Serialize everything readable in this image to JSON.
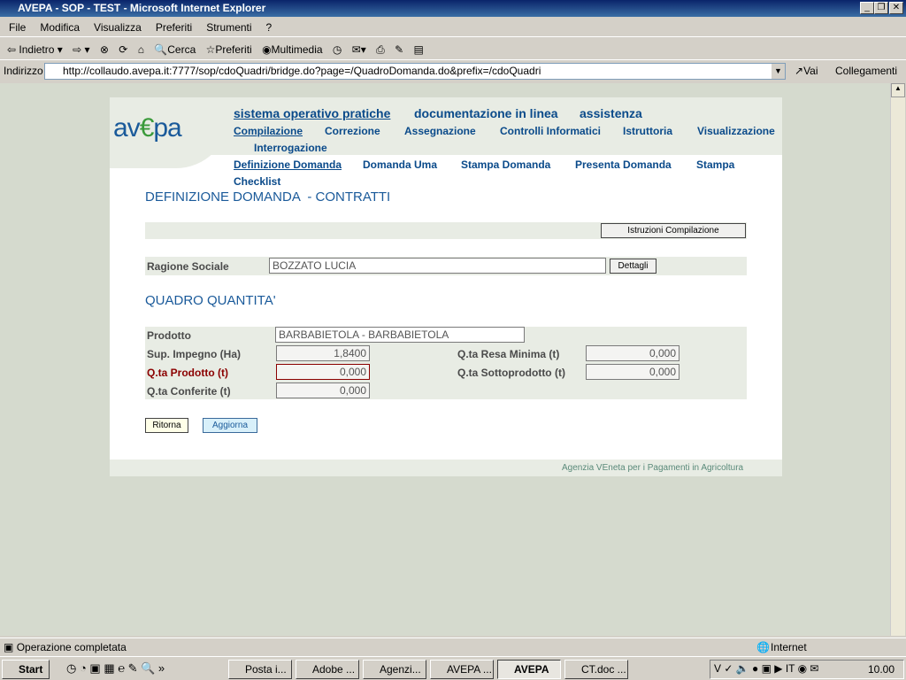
{
  "window": {
    "title": "AVEPA - SOP - TEST - Microsoft Internet Explorer"
  },
  "menu": [
    "File",
    "Modifica",
    "Visualizza",
    "Preferiti",
    "Strumenti",
    "?"
  ],
  "toolbar": {
    "back": "Indietro",
    "search": "Cerca",
    "favorites": "Preferiti",
    "media": "Multimedia"
  },
  "address": {
    "label": "Indirizzo",
    "url": "http://collaudo.avepa.it:7777/sop/cdoQuadri/bridge.do?page=/QuadroDomanda.do&prefix=/cdoQuadri",
    "go": "Vai",
    "links": "Collegamenti"
  },
  "page": {
    "logo": "avepa",
    "top_nav": [
      "sistema operativo pratiche",
      "documentazione in linea",
      "assistenza"
    ],
    "main_nav": [
      "Compilazione",
      "Correzione",
      "Assegnazione",
      "Controlli Informatici",
      "Istruttoria",
      "Visualizzazione",
      "Interrogazione"
    ],
    "sub_nav": [
      "Definizione Domanda",
      "Domanda Uma",
      "Stampa Domanda",
      "Presenta Domanda",
      "Stampa",
      "Checklist"
    ],
    "title": "DEFINIZIONE DOMANDA  - CONTRATTI",
    "instructions_button": "Istruzioni Compilazione",
    "ragione_label": "Ragione Sociale",
    "ragione_value": "BOZZATO LUCIA",
    "details_button": "Dettagli",
    "section_title": "QUADRO QUANTITA'",
    "fields": {
      "prodotto": {
        "label": "Prodotto",
        "value": "BARBABIETOLA - BARBABIETOLA"
      },
      "sup": {
        "label": "Sup. Impegno (Ha)",
        "value": "1,8400"
      },
      "resa": {
        "label": "Q.ta Resa Minima (t)",
        "value": "0,000"
      },
      "prodotto_q": {
        "label": "Q.ta Prodotto (t)",
        "value": "0,000"
      },
      "sotto": {
        "label": "Q.ta Sottoprodotto (t)",
        "value": "0,000"
      },
      "conferite": {
        "label": "Q.ta Conferite (t)",
        "value": "0,000"
      }
    },
    "back_button": "Ritorna",
    "update_button": "Aggiorna",
    "footer": "Agenzia VEneta per i Pagamenti in Agricoltura"
  },
  "status": {
    "text": "Operazione completata",
    "zone": "Internet"
  },
  "taskbar": {
    "start": "Start",
    "tasks": [
      "Posta i...",
      "Adobe ...",
      "Agenzi...",
      "AVEPA ...",
      "AVEPA ...",
      "CT.doc ..."
    ],
    "clock": "10.00"
  },
  "colors": {
    "accent": "#0a4a8a",
    "required": "#8b0000",
    "background": "#d5dace"
  }
}
